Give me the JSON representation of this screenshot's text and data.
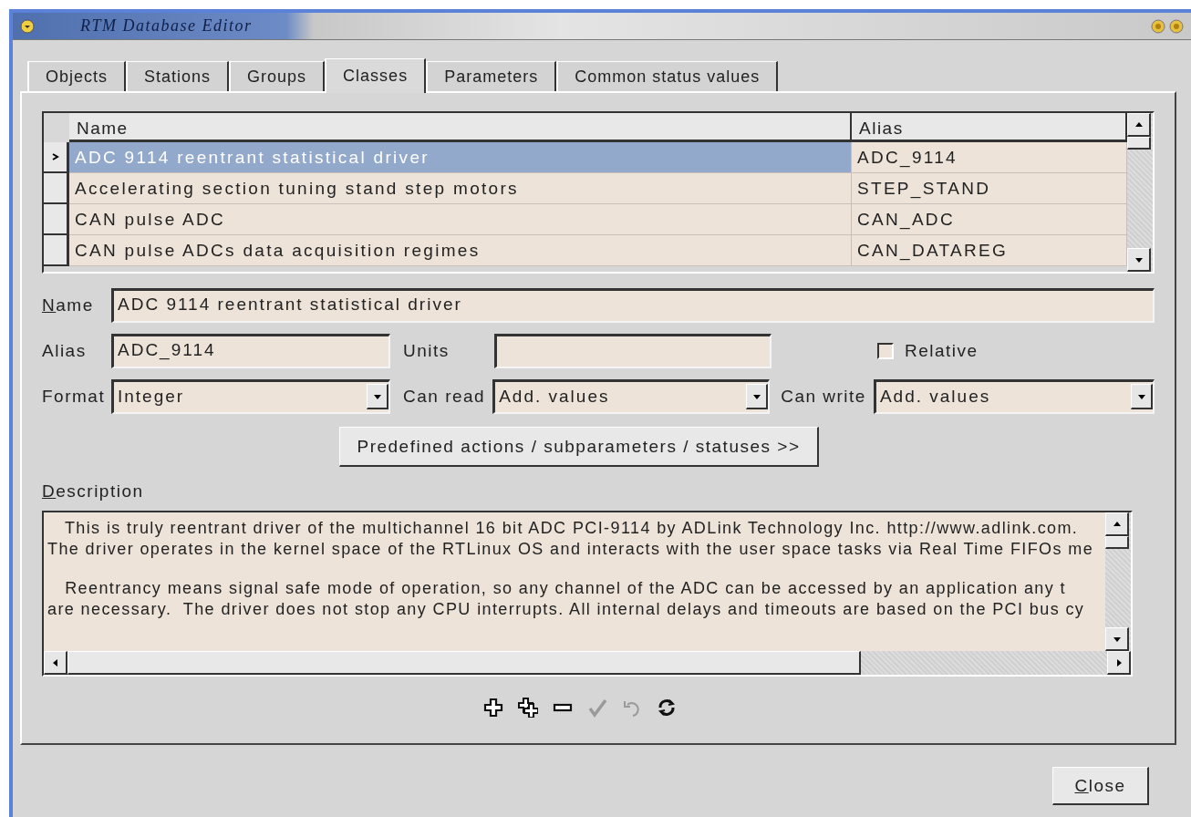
{
  "window": {
    "title": "RTM Database Editor"
  },
  "tabs": [
    {
      "label": "Objects",
      "selected": false
    },
    {
      "label": "Stations",
      "selected": false
    },
    {
      "label": "Groups",
      "selected": false
    },
    {
      "label": "Classes",
      "selected": true
    },
    {
      "label": "Parameters",
      "selected": false
    },
    {
      "label": "Common status values",
      "selected": false
    }
  ],
  "table": {
    "columns": [
      "Name",
      "Alias"
    ],
    "rows": [
      {
        "name": "ADC 9114 reentrant statistical driver",
        "alias": "ADC_9114",
        "selected": true
      },
      {
        "name": "Accelerating section tuning stand step motors",
        "alias": "STEP_STAND",
        "selected": false
      },
      {
        "name": "CAN pulse ADC",
        "alias": "CAN_ADC",
        "selected": false
      },
      {
        "name": "CAN pulse ADCs data acquisition regimes",
        "alias": "CAN_DATAREG",
        "selected": false
      }
    ]
  },
  "form": {
    "name": {
      "label": "Name",
      "mnemonic": true,
      "value": "ADC 9114 reentrant statistical driver"
    },
    "alias": {
      "label": "Alias",
      "value": "ADC_9114"
    },
    "units": {
      "label": "Units"
    },
    "relative": {
      "label": "Relative",
      "checked": false
    },
    "format": {
      "label": "Format",
      "value": "Integer"
    },
    "can_read": {
      "label": "Can read",
      "value": "Add. values"
    },
    "can_write": {
      "label": "Can write",
      "value": "Add. values"
    }
  },
  "actions_button": "Predefined actions / subparameters / statuses >>",
  "description": {
    "label": "Description",
    "mnemonic": true,
    "paragraphs": [
      [
        "   This is truly reentrant driver of the multichannel 16 bit ADC PCI-9114 by ADLink Technology Inc. http://www.adlink.com.",
        "The driver operates in the kernel space of the RTLinux OS and interacts with the user space tasks via Real Time FIFOs me"
      ],
      [
        "   Reentrancy means signal safe mode of operation, so any channel of the ADC can be accessed by an application any t",
        "are necessary.  The driver does not stop any CPU interrupts. All internal delays and timeouts are based on the PCI bus cy"
      ]
    ]
  },
  "toolbar": [
    {
      "kind": "add",
      "disabled": false
    },
    {
      "kind": "duplicate",
      "disabled": false
    },
    {
      "kind": "remove",
      "disabled": false
    },
    {
      "kind": "apply",
      "disabled": true
    },
    {
      "kind": "undo",
      "disabled": true
    },
    {
      "kind": "refresh",
      "disabled": false
    }
  ],
  "close_button": {
    "label": "Close",
    "mnemonic": true
  }
}
